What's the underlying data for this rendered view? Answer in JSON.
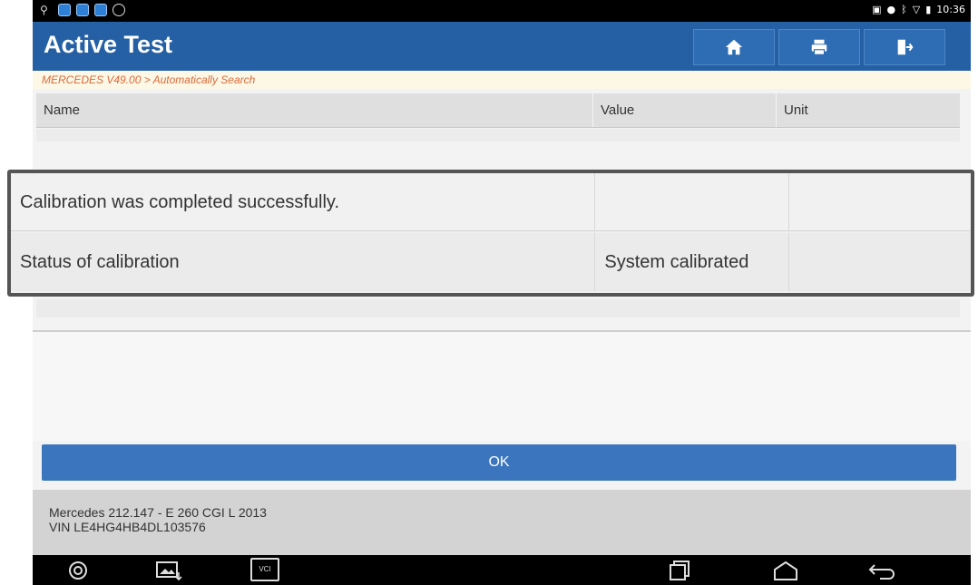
{
  "status_bar": {
    "time": "10:36"
  },
  "header": {
    "title": "Active Test",
    "buttons": [
      {
        "icon": "home-icon"
      },
      {
        "icon": "print-icon"
      },
      {
        "icon": "exit-icon"
      }
    ]
  },
  "breadcrumb": "MERCEDES V49.00 > Automatically Search",
  "table": {
    "columns": [
      "Name",
      "Value",
      "Unit"
    ],
    "rows": [
      {
        "name": "Calibration was completed successfully.",
        "value": "",
        "unit": ""
      },
      {
        "name": "Status of calibration",
        "value": "System calibrated",
        "unit": ""
      }
    ]
  },
  "actions": {
    "ok_label": "OK"
  },
  "vehicle": {
    "model_line": "Mercedes 212.147 - E 260 CGI L 2013",
    "vin_line": "VIN LE4HG4HB4DL103576"
  },
  "nav_bar": {
    "vci_label": "VCI"
  },
  "colors": {
    "title_bar": "#2560a5",
    "breadcrumb_text": "#d86a3b",
    "ok_button": "#3a75bd"
  }
}
